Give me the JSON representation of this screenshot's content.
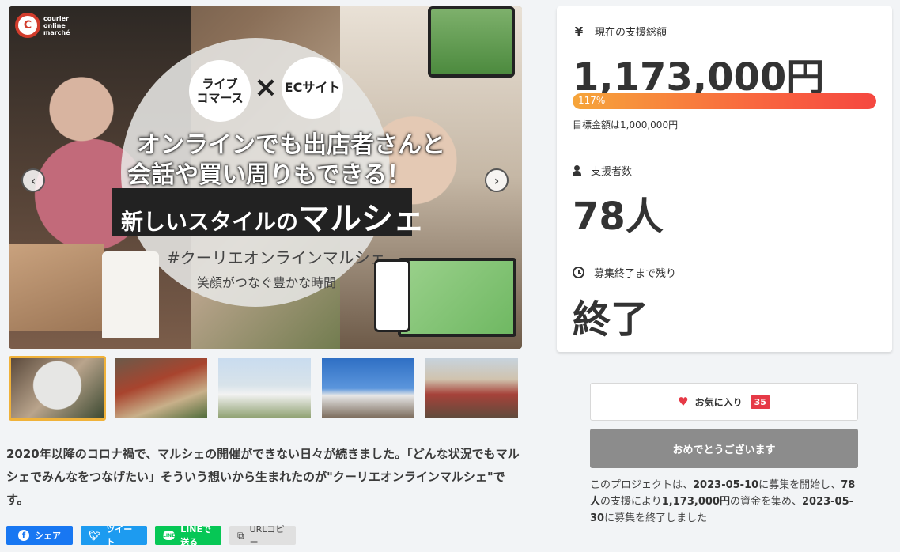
{
  "hero": {
    "logo_text": "courier\nonline\nmarché",
    "bubble_live": "ライブ\nコマース",
    "bubble_ec": "ECサイト",
    "cross": "×",
    "headline1": "オンラインでも出店者さんと",
    "headline2": "会話や買い周りもできる！",
    "headline3_pre": "新しいスタイルの",
    "headline3_big": "マルシェ",
    "tagline": "#クーリエオンラインマルシェ",
    "subtagline": "笑顔がつなぐ豊かな時間",
    "prev_icon": "chevron-left-icon",
    "next_icon": "chevron-right-icon"
  },
  "thumbnails": [
    {
      "active": true
    },
    {
      "active": false
    },
    {
      "active": false
    },
    {
      "active": false
    },
    {
      "active": false
    }
  ],
  "description": "2020年以降のコロナ禍で、マルシェの開催ができない日々が続きました。「どんな状況でもマルシェでみんなをつなげたい」そういう想いから生まれたのが\"クーリエオンラインマルシェ\"です。",
  "share": {
    "facebook": "シェア",
    "twitter": "ツイート",
    "line": "LINEで送る",
    "line_icon_text": "LINE",
    "copy": "URLコピー"
  },
  "stats": {
    "amount_label": "現在の支援総額",
    "amount": "1,173,000円",
    "progress_label": "117%",
    "progress_percent": 117,
    "goal": "目標金額は1,000,000円",
    "backers_label": "支援者数",
    "backers": "78人",
    "remaining_label": "募集終了まで残り",
    "remaining": "終了"
  },
  "favorite": {
    "label": "お気に入り",
    "count": "35"
  },
  "congrats_label": "おめでとうございます",
  "summary": {
    "p1": "このプロジェクトは、",
    "start": "2023-05-10",
    "p2": "に募集を開始し、",
    "backers": "78人",
    "p3": "の支援により",
    "amount": "1,173,000円",
    "p4": "の資金を集め、",
    "end": "2023-05-30",
    "p5": "に募集を終了しました"
  },
  "colors": {
    "accent_red": "#e63946",
    "progress_start": "#f6a53a",
    "progress_end": "#f54740",
    "facebook": "#1877f2",
    "twitter": "#1d9bf0",
    "line": "#06c755",
    "thumb_active": "#f0b23a"
  }
}
